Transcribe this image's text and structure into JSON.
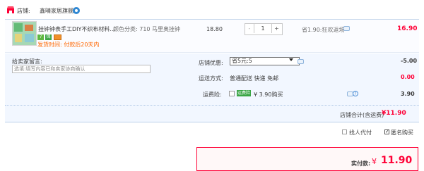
{
  "shop": {
    "prefix": "店铺:",
    "name": "鑫晴家居旗舰店",
    "icon": "shop-icon",
    "badge_icon": "info-badge-icon"
  },
  "item": {
    "title": "挂钟钟表手工DIY不织布材料...",
    "spec": "颜色分类: 710 马里奥挂钟",
    "badges": [
      "7",
      "保",
      "card"
    ],
    "ship_time": "发货时间: 付款后20天内",
    "unit_price": "18.80",
    "quantity": "1",
    "stepper_minus": "-",
    "stepper_plus": "+",
    "discount": "省1.90:狂欢返场",
    "subtotal": "16.90"
  },
  "options": {
    "message_label": "给卖家留言:",
    "message_placeholder": "选填:填写内容已和卖家协商确认",
    "coupon_label": "店铺优惠:",
    "coupon_selected": "省5元:5",
    "coupon_amount": "-5.00",
    "delivery_label": "运送方式:",
    "delivery_value": "普通配送 快递 免邮",
    "delivery_fee": "0.00",
    "insurance_label": "运费险:",
    "insurance_badge": "运费险",
    "insurance_price": "¥ 3.90购买",
    "insurance_help": "?",
    "insurance_amount": "3.90"
  },
  "shop_total": {
    "label": "店铺合计(含运费)",
    "value": "¥11.90"
  },
  "footer": {
    "friend_pay_label": "找人代付",
    "anonymous_label": "匿名购买",
    "pay_label": "实付款:",
    "pay_currency": "¥",
    "pay_amount": "11.90"
  },
  "colors": {
    "accent": "#ff0036",
    "orange": "#ff6600",
    "panel": "#f2f7ff"
  }
}
